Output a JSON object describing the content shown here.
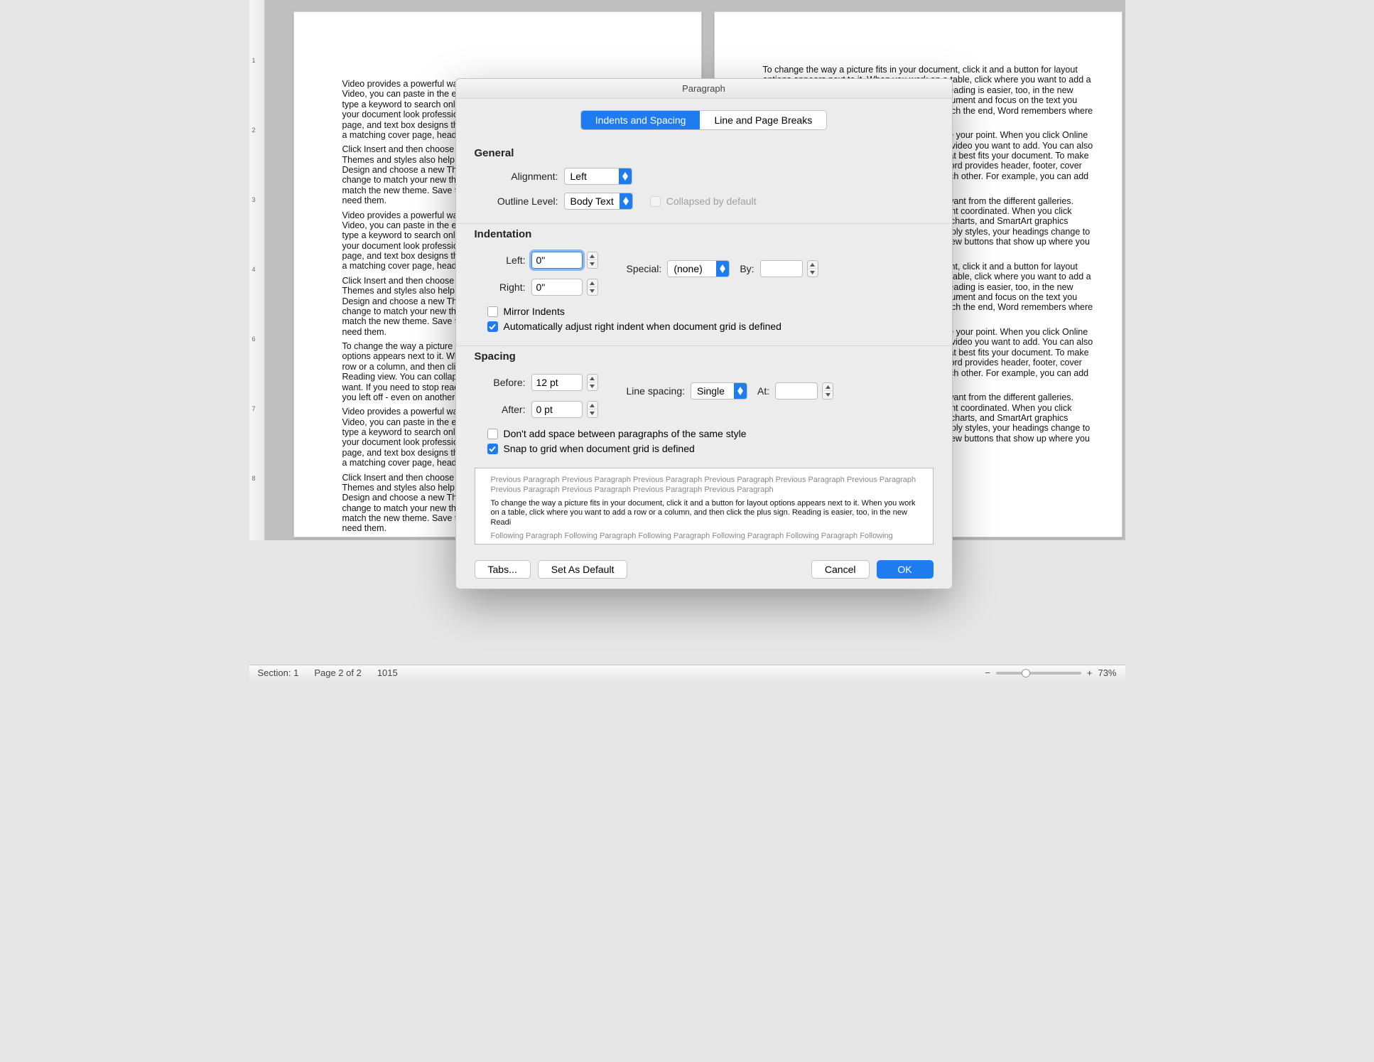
{
  "dialog": {
    "title": "Paragraph",
    "tabs": {
      "indents": "Indents and Spacing",
      "breaks": "Line and Page Breaks"
    },
    "general": {
      "heading": "General",
      "alignment_label": "Alignment:",
      "alignment_value": "Left",
      "outline_label": "Outline Level:",
      "outline_value": "Body Text",
      "collapsed_label": "Collapsed by default"
    },
    "indentation": {
      "heading": "Indentation",
      "left_label": "Left:",
      "left_value": "0\"",
      "right_label": "Right:",
      "right_value": "0\"",
      "special_label": "Special:",
      "special_value": "(none)",
      "by_label": "By:",
      "by_value": "",
      "mirror_label": "Mirror Indents",
      "auto_adjust_label": "Automatically adjust right indent when document grid is defined"
    },
    "spacing": {
      "heading": "Spacing",
      "before_label": "Before:",
      "before_value": "12 pt",
      "after_label": "After:",
      "after_value": "0 pt",
      "line_spacing_label": "Line spacing:",
      "line_spacing_value": "Single",
      "at_label": "At:",
      "at_value": "",
      "no_space_label": "Don't add space between paragraphs of the same style",
      "snap_label": "Snap to grid when document grid is defined"
    },
    "preview": {
      "prev": "Previous Paragraph Previous Paragraph Previous Paragraph Previous Paragraph Previous Paragraph Previous Paragraph Previous Paragraph Previous Paragraph Previous Paragraph Previous Paragraph",
      "body": "To change the way a picture fits in your document, click it and a button for layout options appears next to it. When you work on a table, click where you want to add a row or a column, and then click the plus sign. Reading is easier, too, in the new Readi",
      "next": "Following Paragraph Following Paragraph Following Paragraph Following Paragraph Following Paragraph Following"
    },
    "buttons": {
      "tabs": "Tabs...",
      "set_default": "Set As Default",
      "cancel": "Cancel",
      "ok": "OK"
    }
  },
  "doc": {
    "p1": "Video provides a powerful way to help you prove your point. When you click Online Video, you can paste in the embed code for the video you want to add. You can also type a keyword to search online for the video that best fits your document. To make your document look professionally produced, Word provides header, footer, cover page, and text box designs that complement each other. For example, you can add a matching cover page, header, and sidebar.",
    "p2": "Click Insert and then choose the elements you want from the different galleries. Themes and styles also help keep your document coordinated. When you click Design and choose a new Theme, the pictures, charts, and SmartArt graphics change to match your new theme. When you apply styles, your headings change to match the new theme. Save time in Word with new buttons that show up where you need them.",
    "p3": "To change the way a picture fits in your document, click it and a button for layout options appears next to it. When you work on a table, click where you want to add a row or a column, and then click the plus sign. Reading is easier, too, in the new Reading view. You can collapse parts of the document and focus on the text you want. If you need to stop reading before you reach the end, Word remembers where you left off - even on another device."
  },
  "status": {
    "section": "Section: 1",
    "page": "Page 2 of 2",
    "words": "1015",
    "zoom_minus": "−",
    "zoom_plus": "+",
    "zoom": "73%"
  }
}
